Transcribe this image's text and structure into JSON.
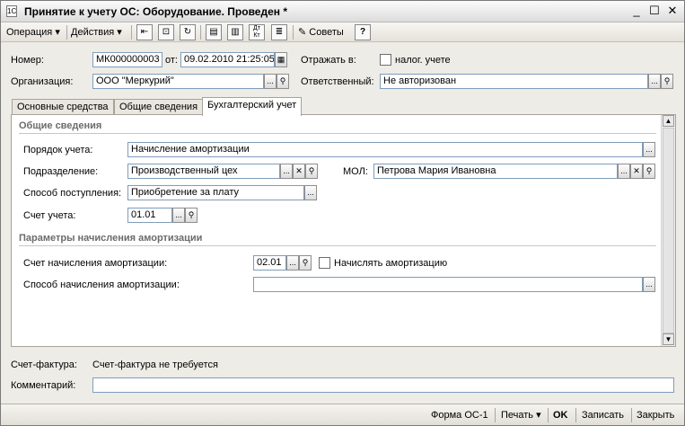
{
  "window": {
    "title": "Принятие к учету ОС: Оборудование. Проведен *",
    "app_icon": "1С",
    "minimize": "_",
    "maximize": "☐",
    "close": "✕"
  },
  "toolbar": {
    "operation": "Операция",
    "actions": "Действия",
    "advice": "Советы",
    "help": "?",
    "dropdown_arrow": "▾",
    "dt_kt": "Дт Кт"
  },
  "header": {
    "number_label": "Номер:",
    "number_value": "МК000000003",
    "date_label": "от:",
    "date_value": "09.02.2010 21:25:05",
    "reflect_label": "Отражать в:",
    "tax_label": "налог. учете",
    "org_label": "Организация:",
    "org_value": "ООО \"Меркурий\"",
    "resp_label": "Ответственный:",
    "resp_value": "Не авторизован"
  },
  "tabs": [
    {
      "label": "Основные средства"
    },
    {
      "label": "Общие сведения"
    },
    {
      "label": "Бухгалтерский учет"
    }
  ],
  "general": {
    "section_title": "Общие сведения",
    "accounting_order_label": "Порядок учета:",
    "accounting_order_value": "Начисление амортизации",
    "division_label": "Подразделение:",
    "division_value": "Производственный цех",
    "mol_label": "МОЛ:",
    "mol_value": "Петрова  Мария Ивановна",
    "receipt_method_label": "Способ поступления:",
    "receipt_method_value": "Приобретение за плату",
    "account_label": "Счет учета:",
    "account_value": "01.01"
  },
  "depreciation": {
    "section_title": "Параметры начисления амортизации",
    "account_label": "Счет начисления амортизации:",
    "account_value": "02.01",
    "accrue_label": "Начислять амортизацию",
    "method_label": "Способ начисления амортизации:",
    "method_value": ""
  },
  "footer": {
    "invoice_label": "Счет-фактура:",
    "invoice_value": "Счет-фактура не требуется",
    "comment_label": "Комментарий:",
    "comment_value": ""
  },
  "statusbar": {
    "form_os1": "Форма ОС-1",
    "print": "Печать",
    "ok": "OK",
    "save": "Записать",
    "close": "Закрыть"
  },
  "glyphs": {
    "ellipsis": "...",
    "clear": "✕",
    "search": "🔍",
    "calendar": "▦",
    "up": "▲",
    "down": "▼"
  }
}
